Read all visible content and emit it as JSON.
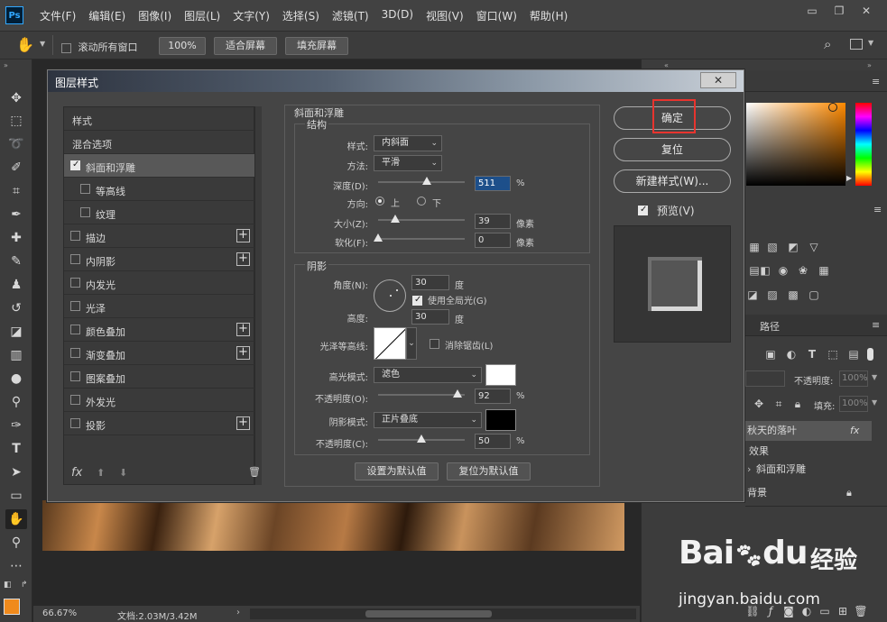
{
  "app": {
    "logo": "Ps"
  },
  "menu": [
    "文件(F)",
    "编辑(E)",
    "图像(I)",
    "图层(L)",
    "文字(Y)",
    "选择(S)",
    "滤镜(T)",
    "3D(D)",
    "视图(V)",
    "窗口(W)",
    "帮助(H)"
  ],
  "window_controls": {
    "minimize": "▭",
    "restore": "❐",
    "close": "✕"
  },
  "options_bar": {
    "scroll_all_label": "滚动所有窗口",
    "zoom_btn": "100%",
    "fit_btn": "适合屏幕",
    "fill_btn": "填充屏幕"
  },
  "status_bar": {
    "zoom": "66.67%",
    "doc": "文档:2.03M/3.42M"
  },
  "right_panel": {
    "paths_tab": "路径",
    "opacity_label": "不透明度:",
    "opacity_value": "100%",
    "fill_label": "填充:",
    "fill_value": "100%",
    "layers": {
      "layer_name": "秋天的落叶",
      "fx": "fx",
      "effects": "效果",
      "effect_item": "斜面和浮雕",
      "background": "背景"
    }
  },
  "dialog": {
    "title": "图层样式",
    "close": "✕",
    "styles": {
      "header": "样式",
      "blending": "混合选项",
      "items": [
        {
          "label": "斜面和浮雕",
          "checked": true,
          "selected": true,
          "plus": false,
          "indent": false
        },
        {
          "label": "等高线",
          "checked": false,
          "selected": false,
          "plus": false,
          "indent": true
        },
        {
          "label": "纹理",
          "checked": false,
          "selected": false,
          "plus": false,
          "indent": true
        },
        {
          "label": "描边",
          "checked": false,
          "selected": false,
          "plus": true,
          "indent": false
        },
        {
          "label": "内阴影",
          "checked": false,
          "selected": false,
          "plus": true,
          "indent": false
        },
        {
          "label": "内发光",
          "checked": false,
          "selected": false,
          "plus": false,
          "indent": false
        },
        {
          "label": "光泽",
          "checked": false,
          "selected": false,
          "plus": false,
          "indent": false
        },
        {
          "label": "颜色叠加",
          "checked": false,
          "selected": false,
          "plus": true,
          "indent": false
        },
        {
          "label": "渐变叠加",
          "checked": false,
          "selected": false,
          "plus": true,
          "indent": false
        },
        {
          "label": "图案叠加",
          "checked": false,
          "selected": false,
          "plus": false,
          "indent": false
        },
        {
          "label": "外发光",
          "checked": false,
          "selected": false,
          "plus": false,
          "indent": false
        },
        {
          "label": "投影",
          "checked": false,
          "selected": false,
          "plus": true,
          "indent": false
        }
      ],
      "footer_fx": "fx"
    },
    "bevel": {
      "group_title": "斜面和浮雕",
      "structure_title": "结构",
      "style_label": "样式:",
      "style_value": "内斜面",
      "technique_label": "方法:",
      "technique_value": "平滑",
      "depth_label": "深度(D):",
      "depth_value": "511",
      "depth_percent": 0.56,
      "depth_unit": "%",
      "direction_label": "方向:",
      "direction_up": "上",
      "direction_down": "下",
      "size_label": "大小(Z):",
      "size_value": "39",
      "size_fraction": 0.2,
      "size_unit": "像素",
      "soften_label": "软化(F):",
      "soften_value": "0",
      "soften_fraction": 0,
      "soften_unit": "像素"
    },
    "shading": {
      "title": "阴影",
      "angle_label": "角度(N):",
      "angle_value": "30",
      "angle_unit": "度",
      "global_light_label": "使用全局光(G)",
      "altitude_label": "高度:",
      "altitude_value": "30",
      "altitude_unit": "度",
      "gloss_label": "光泽等高线:",
      "antialias_label": "消除锯齿(L)",
      "highlight_mode_label": "高光模式:",
      "highlight_mode_value": "滤色",
      "highlight_color": "#ffffff",
      "highlight_opacity_label": "不透明度(O):",
      "highlight_opacity_value": "92",
      "highlight_opacity_fraction": 0.92,
      "shadow_mode_label": "阴影模式:",
      "shadow_mode_value": "正片叠底",
      "shadow_color": "#000000",
      "shadow_opacity_label": "不透明度(C):",
      "shadow_opacity_value": "50",
      "shadow_opacity_fraction": 0.5,
      "percent": "%"
    },
    "buttons": {
      "make_default": "设置为默认值",
      "reset_default": "复位为默认值",
      "ok": "确定",
      "reset": "复位",
      "new_style": "新建样式(W)...",
      "preview": "预览(V)"
    }
  },
  "watermark": {
    "brand": "Bai",
    "brand2": "du",
    "cn": "经验",
    "url": "jingyan.baidu.com"
  }
}
